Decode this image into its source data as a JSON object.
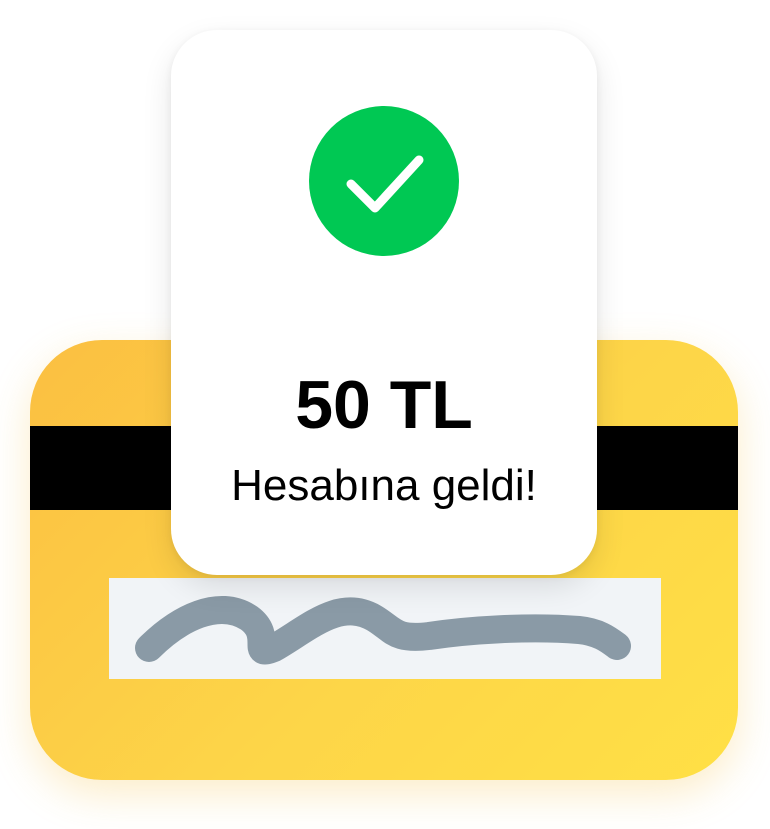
{
  "receipt": {
    "amount": "50 TL",
    "message": "Hesabına geldi!",
    "icon": "checkmark-icon",
    "icon_color": "#00c853"
  },
  "card": {
    "color": "#fdd548",
    "stripe_color": "#000000",
    "signature_panel_color": "#f1f4f7",
    "signature_color": "#8a9aa6"
  }
}
